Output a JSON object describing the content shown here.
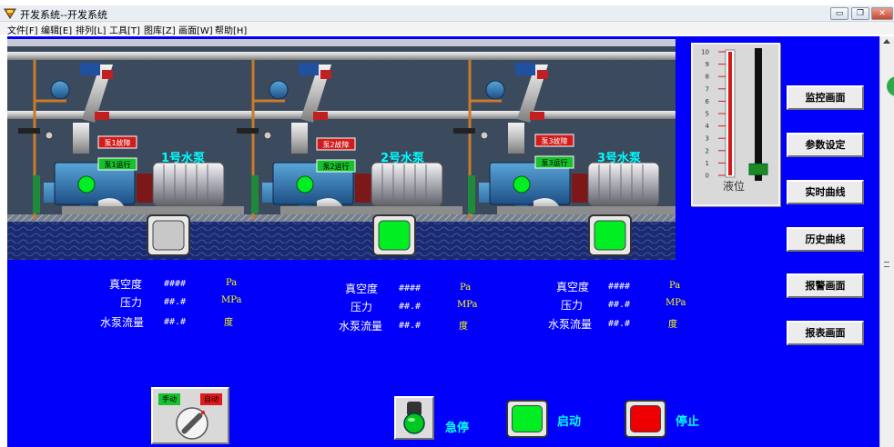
{
  "window": {
    "title": "开发系统--开发系统",
    "minimize": "▭",
    "restore": "❐",
    "close": "✕"
  },
  "menu": [
    {
      "label": "文件[F]"
    },
    {
      "label": "编辑[E]"
    },
    {
      "label": "排列[L]"
    },
    {
      "label": "工具[T]"
    },
    {
      "label": "图库[Z]"
    },
    {
      "label": "画面[W]"
    },
    {
      "label": "帮助[H]"
    }
  ],
  "pumps": [
    {
      "name": "1号水泵",
      "fault_label": "泵1故障",
      "run_label": "泵1运行",
      "button_color": "#c8c8c8",
      "vacuum_label": "真空度",
      "vacuum_value": "####",
      "vacuum_unit": "Pa",
      "pressure_label": "压力",
      "pressure_value": "##.#",
      "pressure_unit": "MPa",
      "flow_label": "水泵流量",
      "flow_value": "##.#",
      "flow_unit": "度"
    },
    {
      "name": "2号水泵",
      "fault_label": "泵2故障",
      "run_label": "泵2运行",
      "button_color": "#00ee22",
      "vacuum_label": "真空度",
      "vacuum_value": "####",
      "vacuum_unit": "Pa",
      "pressure_label": "压力",
      "pressure_value": "##.#",
      "pressure_unit": "MPa",
      "flow_label": "水泵流量",
      "flow_value": "##.#",
      "flow_unit": "度"
    },
    {
      "name": "3号水泵",
      "fault_label": "泵3故障",
      "run_label": "泵3运行",
      "button_color": "#00ee22",
      "vacuum_label": "真空度",
      "vacuum_value": "####",
      "vacuum_unit": "Pa",
      "pressure_label": "压力",
      "pressure_value": "##.#",
      "pressure_unit": "MPa",
      "flow_label": "水泵流量",
      "flow_value": "##.#",
      "flow_unit": "度"
    }
  ],
  "level": {
    "label": "液位",
    "ticks": [
      "10",
      "9",
      "8",
      "7",
      "6",
      "5",
      "4",
      "3",
      "2",
      "1",
      "0"
    ],
    "slider_fraction": 0.05
  },
  "nav": [
    {
      "label": "监控画面"
    },
    {
      "label": "参数设定"
    },
    {
      "label": "实时曲线"
    },
    {
      "label": "历史曲线"
    },
    {
      "label": "报警画面"
    },
    {
      "label": "报表画面"
    }
  ],
  "mode_switch": {
    "manual": "手动",
    "auto": "自动"
  },
  "controls": {
    "estop": "急停",
    "start": "启动",
    "stop": "停止"
  },
  "colors": {
    "background": "#0000fb",
    "run_green": "#00ee22",
    "stop_red": "#ee0000",
    "label_cyan": "#00ffff",
    "unit_yellow": "#ffff00"
  }
}
